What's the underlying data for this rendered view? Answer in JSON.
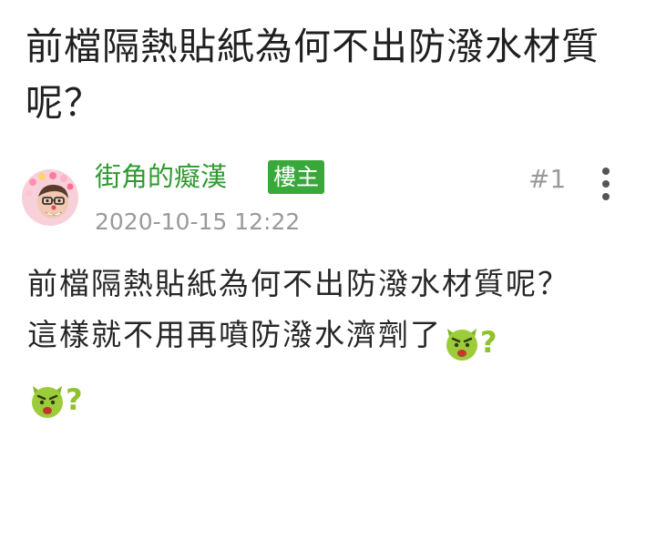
{
  "post": {
    "title": "前檔隔熱貼紙為何不出防潑水材質呢？",
    "author": "街角的癡漢",
    "author_badge": "樓主",
    "timestamp": "2020-10-15 12:22",
    "floor": "#1",
    "content_line1": "前檔隔熱貼紙為何不出防潑水材質呢？",
    "content_line2": "這樣就不用再噴防潑水濟劑了",
    "emoji_question_1": "?",
    "emoji_question_2": "?"
  },
  "icons": {
    "avatar": "clown-avatar",
    "more": "vertical-ellipsis-icon",
    "emoji": "angry-green-face-icon"
  },
  "colors": {
    "author": "#2f9a2f",
    "badge_bg": "#38a838",
    "meta": "#9a9a9a",
    "emoji_green": "#8fc22b"
  }
}
